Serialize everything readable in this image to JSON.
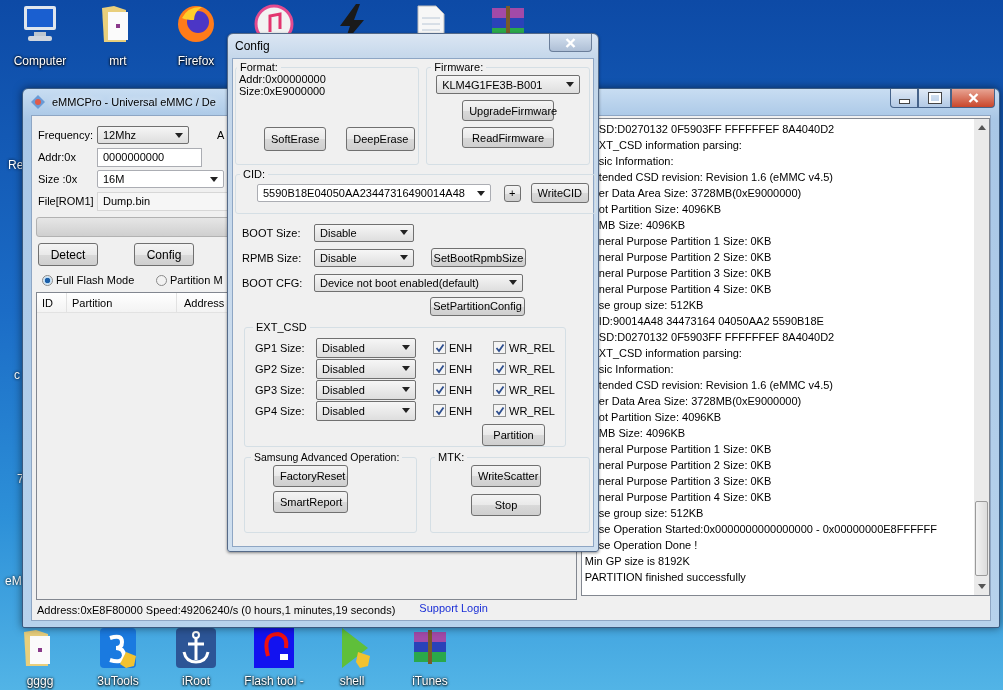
{
  "desktop": {
    "top_icons": [
      {
        "kind": "computer",
        "label": "Computer"
      },
      {
        "kind": "folder",
        "label": "mrt"
      },
      {
        "kind": "browser",
        "label": "Firefox"
      },
      {
        "kind": "music"
      },
      {
        "kind": "lightning"
      },
      {
        "kind": "document"
      },
      {
        "kind": "archive"
      }
    ],
    "edge_labels": [
      "Re",
      "c",
      "7",
      "eM"
    ],
    "bottom_icons": [
      {
        "kind": "folder",
        "label": "gggg"
      },
      {
        "kind": "tools",
        "label": "3uTools"
      },
      {
        "kind": "anchor",
        "label": "iRoot"
      },
      {
        "kind": "flash",
        "label": "Flash tool -"
      },
      {
        "kind": "play",
        "label": "shell"
      },
      {
        "kind": "archive",
        "label": "iTunes"
      }
    ]
  },
  "main_window": {
    "title": "eMMCPro - Universal eMMC / De",
    "frequency": {
      "label": "Frequency:",
      "value": "12Mhz"
    },
    "cut_label": "A",
    "addr": {
      "label": "Addr:0x",
      "value": "0000000000"
    },
    "size": {
      "label": "Size :0x",
      "value": "16M"
    },
    "file": {
      "label": "File[ROM1]",
      "value": "Dump.bin"
    },
    "progress": {
      "level": 0
    },
    "buttons": [
      "Detect",
      "Config"
    ],
    "modes": [
      {
        "label": "Full Flash Mode",
        "selected": true
      },
      {
        "label": "Partition M",
        "selected": false
      }
    ],
    "table": {
      "columns": [
        "ID",
        "Partition",
        "Address"
      ]
    },
    "log": [
      {
        "kind": "clipped",
        "text": "SD:D0270132 0F5903FF FFFFFFEF 8A4040D2"
      },
      {
        "kind": "clipped",
        "text": "XT_CSD information parsing:"
      },
      {
        "kind": "clipped",
        "text": "sic Information:"
      },
      {
        "kind": "clipped",
        "text": "tended CSD revision: Revision 1.6 (eMMC v4.5)"
      },
      {
        "kind": "clipped",
        "text": "er Data Area Size: 3728MB(0xE9000000)"
      },
      {
        "kind": "clipped",
        "text": "ot Partition Size: 4096KB"
      },
      {
        "kind": "clipped",
        "text": "MB Size: 4096KB"
      },
      {
        "kind": "clipped",
        "text": "neral Purpose Partition 1 Size: 0KB"
      },
      {
        "kind": "clipped",
        "text": "neral Purpose Partition 2 Size: 0KB"
      },
      {
        "kind": "clipped",
        "text": "neral Purpose Partition 3 Size: 0KB"
      },
      {
        "kind": "clipped",
        "text": "neral Purpose Partition 4 Size: 0KB"
      },
      {
        "kind": "clipped",
        "text": "se group size: 512KB"
      },
      {
        "kind": "clipped",
        "text": "ID:90014A48 34473164 04050AA2 5590B18E"
      },
      {
        "kind": "clipped",
        "text": "SD:D0270132 0F5903FF FFFFFFEF 8A4040D2"
      },
      {
        "kind": "clipped",
        "text": "XT_CSD information parsing:"
      },
      {
        "kind": "clipped",
        "text": "sic Information:"
      },
      {
        "kind": "clipped",
        "text": "tended CSD revision: Revision 1.6 (eMMC v4.5)"
      },
      {
        "kind": "clipped",
        "text": "er Data Area Size: 3728MB(0xE9000000)"
      },
      {
        "kind": "clipped",
        "text": "ot Partition Size: 4096KB"
      },
      {
        "kind": "clipped",
        "text": "MB Size: 4096KB"
      },
      {
        "kind": "clipped",
        "text": "neral Purpose Partition 1 Size: 0KB"
      },
      {
        "kind": "clipped",
        "text": "neral Purpose Partition 2 Size: 0KB"
      },
      {
        "kind": "clipped",
        "text": "neral Purpose Partition 3 Size: 0KB"
      },
      {
        "kind": "clipped",
        "text": "neral Purpose Partition 4 Size: 0KB"
      },
      {
        "kind": "clipped",
        "text": "se group size: 512KB"
      },
      {
        "kind": "clipped",
        "text": "se Operation Started:0x0000000000000000 - 0x00000000E8FFFFFF"
      },
      {
        "kind": "clipped",
        "text": "se Operation Done !"
      },
      {
        "kind": "full",
        "text": "Min GP size is 8192K"
      },
      {
        "kind": "full",
        "text": "PARTITION finished successfully"
      }
    ],
    "status_bar": {
      "text": "Address:0xE8F80000 Speed:49206240/s (0 hours,1 minutes,19 seconds)",
      "link": "Support Login"
    }
  },
  "config_dialog": {
    "title": "Config",
    "format": {
      "label": "Format:",
      "lines": [
        "Addr:0x00000000",
        "Size:0xE9000000"
      ],
      "buttons": [
        "SoftErase",
        "DeepErase"
      ]
    },
    "firmware": {
      "label": "Firmware:",
      "value": "KLM4G1FE3B-B001",
      "buttons": [
        "UpgradeFirmware",
        "ReadFirmware"
      ]
    },
    "cid": {
      "label": "CID:",
      "value": "5590B18E04050AA23447316490014A48",
      "add": "+",
      "button": "WriteCID"
    },
    "boot_size": {
      "label": "BOOT Size:",
      "value": "Disable"
    },
    "rpmb_size": {
      "label": "RPMB Size:",
      "value": "Disable",
      "button": "SetBootRpmbSize"
    },
    "boot_cfg": {
      "label": "BOOT CFG:",
      "value": "Device not boot enabled(default)",
      "button": "SetPartitionConfig"
    },
    "ext_csd": {
      "label": "EXT_CSD",
      "rows": [
        {
          "label": "GP1 Size:",
          "value": "Disabled",
          "enh": {
            "label": "ENH",
            "checked": true
          },
          "wr_rel": {
            "label": "WR_REL",
            "checked": true
          }
        },
        {
          "label": "GP2 Size:",
          "value": "Disabled",
          "enh": {
            "label": "ENH",
            "checked": true
          },
          "wr_rel": {
            "label": "WR_REL",
            "checked": true
          }
        },
        {
          "label": "GP3 Size:",
          "value": "Disabled",
          "enh": {
            "label": "ENH",
            "checked": true
          },
          "wr_rel": {
            "label": "WR_REL",
            "checked": true
          }
        },
        {
          "label": "GP4 Size:",
          "value": "Disabled",
          "enh": {
            "label": "ENH",
            "checked": true
          },
          "wr_rel": {
            "label": "WR_REL",
            "checked": true
          }
        }
      ],
      "button": "Partition"
    },
    "samsung": {
      "label": "Samsung Advanced Operation:",
      "buttons": [
        "FactoryReset",
        "SmartReport"
      ]
    },
    "mtk": {
      "label": "MTK:",
      "buttons": [
        "WriteScatter",
        "Stop"
      ]
    }
  }
}
